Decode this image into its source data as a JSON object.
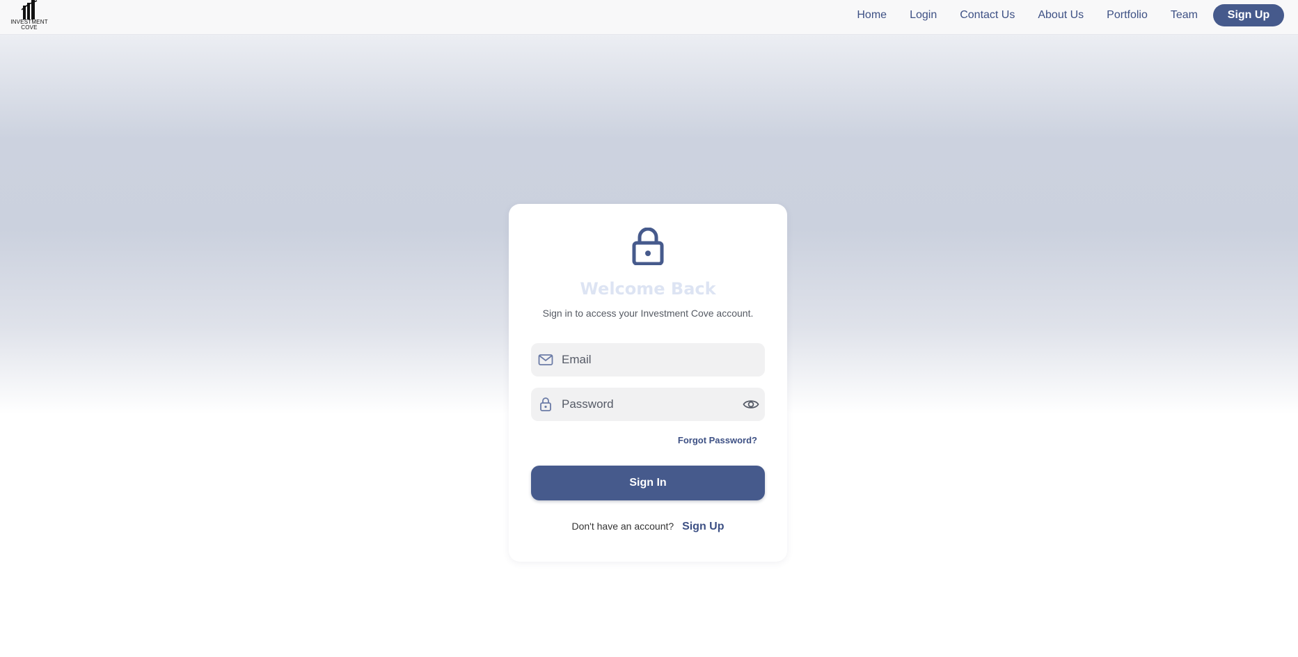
{
  "brand": {
    "logo_line1": "INVESTMENT",
    "logo_line2": "COVE",
    "logo_icon": "building-chart-icon"
  },
  "nav": {
    "items": [
      {
        "label": "Home"
      },
      {
        "label": "Login"
      },
      {
        "label": "Contact Us"
      },
      {
        "label": "About Us"
      },
      {
        "label": "Portfolio"
      },
      {
        "label": "Team"
      }
    ],
    "signup_label": "Sign Up"
  },
  "login": {
    "icon": "lock-icon",
    "title": "Welcome Back",
    "subtitle": "Sign in to access your Investment Cove account.",
    "email_placeholder": "Email",
    "password_placeholder": "Password",
    "forgot_label": "Forgot Password?",
    "signin_label": "Sign In",
    "no_account_prompt": "Don't have an account?",
    "signup_link_label": "Sign Up"
  },
  "colors": {
    "accent": "#465a8c",
    "link": "#3d5084",
    "title": "#dde4f3"
  }
}
